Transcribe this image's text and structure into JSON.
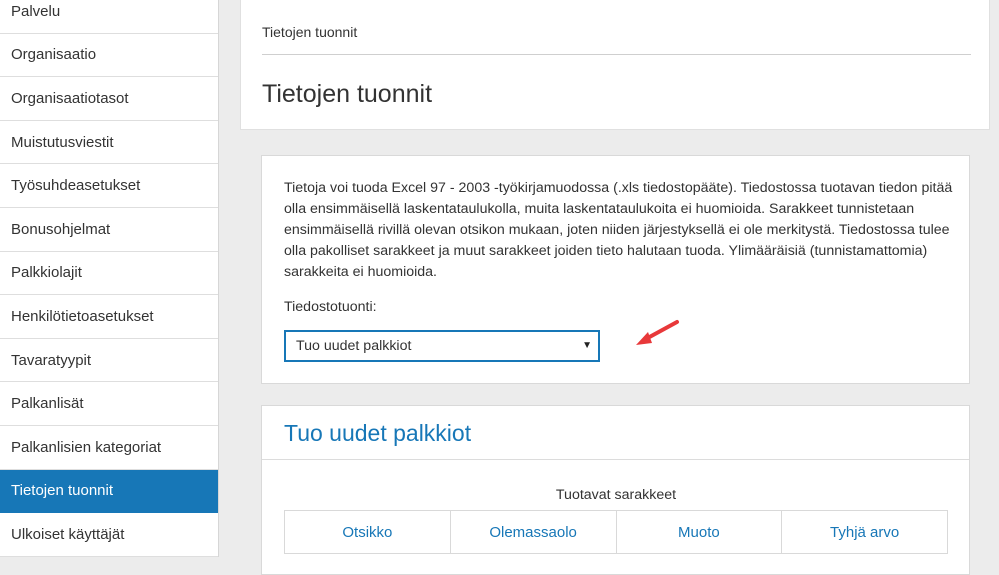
{
  "sidebar": {
    "items": [
      {
        "label": "Palvelu",
        "active": false
      },
      {
        "label": "Organisaatio",
        "active": false
      },
      {
        "label": "Organisaatiotasot",
        "active": false
      },
      {
        "label": "Muistutusviestit",
        "active": false
      },
      {
        "label": "Työsuhdeasetukset",
        "active": false
      },
      {
        "label": "Bonusohjelmat",
        "active": false
      },
      {
        "label": "Palkkiolajit",
        "active": false
      },
      {
        "label": "Henkilötietoasetukset",
        "active": false
      },
      {
        "label": "Tavaratyypit",
        "active": false
      },
      {
        "label": "Palkanlisät",
        "active": false
      },
      {
        "label": "Palkanlisien kategoriat",
        "active": false
      },
      {
        "label": "Tietojen tuonnit",
        "active": true
      },
      {
        "label": "Ulkoiset käyttäjät",
        "active": false
      }
    ]
  },
  "breadcrumb": "Tietojen tuonnit",
  "page_title": "Tietojen tuonnit",
  "info": {
    "text": "Tietoja voi tuoda Excel 97 - 2003 -työkirjamuodossa (.xls tiedostopääte). Tiedostossa tuotavan tiedon pitää olla ensimmäisellä laskentataulukolla, muita laskentataulukoita ei huomioida. Sarakkeet tunnistetaan ensimmäisellä rivillä olevan otsikon mukaan, joten niiden järjestyksellä ei ole merkitystä. Tiedostossa tulee olla pakolliset sarakkeet ja muut sarakkeet joiden tieto halutaan tuoda. Ylimääräisiä (tunnistamattomia) sarakkeita ei huomioida.",
    "import_label": "Tiedostotuonti:",
    "selected_option": "Tuo uudet palkkiot"
  },
  "import_section": {
    "title": "Tuo uudet palkkiot",
    "table_caption": "Tuotavat sarakkeet",
    "columns": [
      "Otsikko",
      "Olemassaolo",
      "Muoto",
      "Tyhjä arvo"
    ]
  },
  "colors": {
    "accent": "#1777b7",
    "annotation_arrow": "#e8383a"
  },
  "icons": {
    "select_caret": "caret-down-icon",
    "annotation": "red-arrow-icon"
  }
}
